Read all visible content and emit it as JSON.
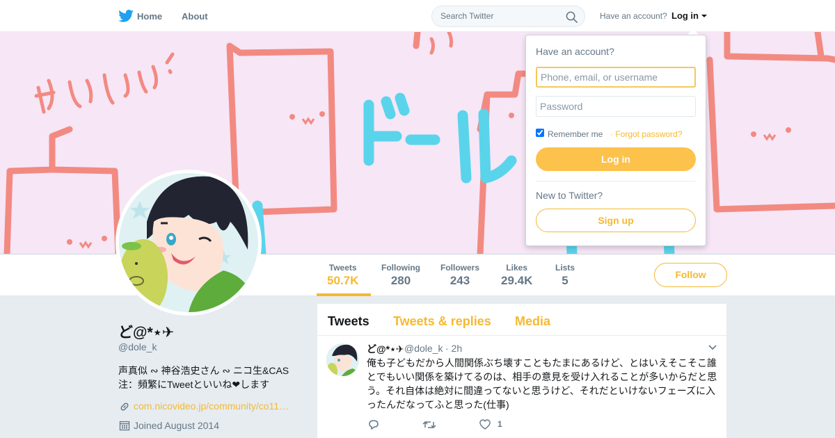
{
  "nav": {
    "home_label": "Home",
    "about_label": "About",
    "search_placeholder": "Search Twitter",
    "have_account": "Have an account?",
    "login_label": "Log in"
  },
  "profile": {
    "name": "ど@*⋆✈",
    "handle": "@dole_k",
    "bio_line1": "声真似 ∾ 神谷浩史さん ∾ ニコ生&CAS",
    "bio_line2": "注：頻繁にTweetといいね❤︎します",
    "url": "com.nicovideo.jp/community/co11…",
    "joined": "Joined August 2014"
  },
  "stats": [
    {
      "label": "Tweets",
      "value": "50.7K",
      "active": true
    },
    {
      "label": "Following",
      "value": "280",
      "active": false
    },
    {
      "label": "Followers",
      "value": "243",
      "active": false
    },
    {
      "label": "Likes",
      "value": "29.4K",
      "active": false
    },
    {
      "label": "Lists",
      "value": "5",
      "active": false
    }
  ],
  "follow_label": "Follow",
  "timeline": {
    "tabs": [
      "Tweets",
      "Tweets & replies",
      "Media"
    ],
    "tweet": {
      "name": "ど@*⋆✈",
      "handle": "@dole_k",
      "time": "· 2h",
      "text": "俺も子どもだから人間関係ぶち壊すこともたまにあるけど、とはいえそこそこ誰とでもいい関係を築けてるのは、相手の意見を受け入れることが多いからだと思う。それ自体は絶対に間違ってないと思うけど、それだといけないフェーズに入ったんだなってふと思った(仕事)",
      "like_count": "1"
    }
  },
  "login_dropdown": {
    "title": "Have an account?",
    "username_placeholder": "Phone, email, or username",
    "password_placeholder": "Password",
    "remember_label": "Remember me",
    "forgot_label": "· Forgot password?",
    "login_button": "Log in",
    "new_label": "New to Twitter?",
    "signup_button": "Sign up"
  },
  "colors": {
    "accent": "#f5b931",
    "login_button_bg": "#fcc24c",
    "banner_bg": "#f6e6f6",
    "twitter_blue": "#1da1f2"
  },
  "icons": {
    "logo": "twitter-bird-icon",
    "search": "search-icon",
    "url": "link-icon",
    "joined": "calendar-icon",
    "reply": "reply-icon",
    "retweet": "retweet-icon",
    "like": "heart-icon"
  }
}
